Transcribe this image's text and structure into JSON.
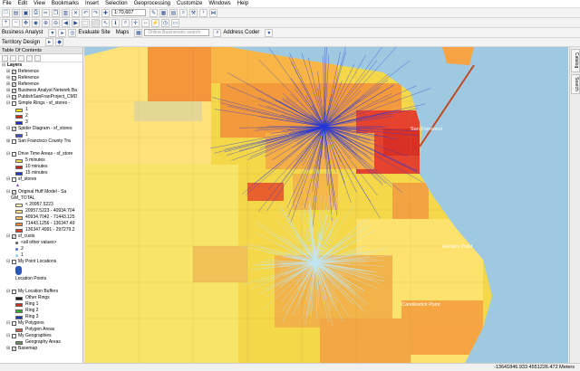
{
  "menubar": [
    "File",
    "Edit",
    "View",
    "Bookmarks",
    "Insert",
    "Selection",
    "Geoprocessing",
    "Customize",
    "Windows",
    "Help"
  ],
  "toolbar": {
    "scale": "1:70,607",
    "business_analyst": "Business Analyst",
    "evaluate_site": "Evaluate Site",
    "maps": "Maps",
    "search_placeholder": "Online Businesses search",
    "address_coder": "Address Coder",
    "territory_design": "Territory Design"
  },
  "toc": {
    "title": "Table Of Contents",
    "rows": [
      {
        "text": "Layers",
        "level": 0,
        "exp": "⊟",
        "check": false,
        "bold": true
      },
      {
        "text": "Reference",
        "level": 1,
        "exp": "⊞",
        "check": true
      },
      {
        "text": "Reference",
        "level": 1,
        "exp": "⊞",
        "check": true
      },
      {
        "text": "Reference",
        "level": 1,
        "exp": "⊞",
        "check": true
      },
      {
        "text": "Business Analyst Network Ba",
        "level": 1,
        "exp": "⊞",
        "check": true
      },
      {
        "text": "PublishSanFranProject_CMD",
        "level": 1,
        "exp": "⊟",
        "check": true
      },
      {
        "text": "Simple Rings - sf_stores -",
        "level": 1,
        "exp": "⊟",
        "check": false
      },
      {
        "text": "1",
        "level": 3,
        "swatch": "#f2e600"
      },
      {
        "text": "2",
        "level": 3,
        "swatch": "#e0261c"
      },
      {
        "text": "3",
        "level": 3,
        "swatch": "#1c2fe0"
      },
      {
        "text": "Spider Diagram - sf_stores",
        "level": 1,
        "exp": "⊟",
        "check": true
      },
      {
        "text": "1",
        "level": 3,
        "swatch": "#3c4fd0"
      },
      {
        "text": "San Francisco County Tra",
        "level": 1,
        "exp": "⊞",
        "check": false
      },
      {
        "text": "",
        "level": 3
      },
      {
        "text": "Drive Time Areas - sf_store",
        "level": 1,
        "exp": "⊟",
        "check": false
      },
      {
        "text": "5 minutes",
        "level": 3,
        "swatch": "#f0d64a"
      },
      {
        "text": "10 minutes",
        "level": 3,
        "swatch": "#d2261b"
      },
      {
        "text": "15 minutes",
        "level": 3,
        "swatch": "#1c3ad4"
      },
      {
        "text": "sf_stores",
        "level": 1,
        "exp": "⊟",
        "check": false
      },
      {
        "text": "▲",
        "level": 3,
        "color": "#7b32b6"
      },
      {
        "text": "Original Huff Model - Sa",
        "level": 1,
        "exp": "⊟",
        "check": true
      },
      {
        "text": "GM_TOTAL",
        "level": 2
      },
      {
        "text": "< 20957.5223",
        "level": 3,
        "swatch": "#ffffb0"
      },
      {
        "text": "20957.5223 - 40934.704",
        "level": 3,
        "swatch": "#fde27a"
      },
      {
        "text": "40934.7042 - 71443.125",
        "level": 3,
        "swatch": "#fdb95a"
      },
      {
        "text": "71443.1256 - 136347.49",
        "level": 3,
        "swatch": "#f7853c"
      },
      {
        "text": "136347.4991 - 297279.2",
        "level": 3,
        "swatch": "#e43a2a"
      },
      {
        "text": "sf_custs",
        "level": 1,
        "exp": "⊟",
        "check": true
      },
      {
        "text": "<all other values>",
        "level": 3,
        "dot": "#555555"
      },
      {
        "text": "2",
        "level": 3,
        "dot": "#5070d8"
      },
      {
        "text": "1",
        "level": 3,
        "dot": "#8fd0f0"
      },
      {
        "text": "My Point Locations",
        "level": 1,
        "exp": "⊟",
        "check": false
      },
      {
        "text": "",
        "level": 3,
        "pin": true
      },
      {
        "text": "Location Points",
        "level": 3
      },
      {
        "text": "",
        "level": 3
      },
      {
        "text": "My Location Buffers",
        "level": 1,
        "exp": "⊟",
        "check": false
      },
      {
        "text": "Other Rings",
        "level": 3,
        "swatch": "#1a1a1a"
      },
      {
        "text": "Ring 1",
        "level": 3,
        "swatch": "#d42a1f"
      },
      {
        "text": "Ring 2",
        "level": 3,
        "swatch": "#2fb32a"
      },
      {
        "text": "Ring 3",
        "level": 3,
        "swatch": "#2438c8"
      },
      {
        "text": "My Polygons",
        "level": 1,
        "exp": "⊟",
        "check": false
      },
      {
        "text": "Polygon Areas",
        "level": 3,
        "swatch": "#c85a50"
      },
      {
        "text": "My Geographies",
        "level": 1,
        "exp": "⊟",
        "check": false
      },
      {
        "text": "Geography Areas",
        "level": 3,
        "swatch": "#6c8a5a"
      },
      {
        "text": "Basemap",
        "level": 1,
        "exp": "⊞",
        "check": true
      }
    ]
  },
  "map_labels": {
    "san_francisco": "San Francisco",
    "hunters_point": "Hunters Point",
    "candlestick_point": "Candlestick Point"
  },
  "right_tabs": [
    "Catalog",
    "Search"
  ],
  "status": {
    "coords": "-13641846.933  4551226.472 Meters"
  },
  "colors": {
    "water": "#9ec9e0",
    "spider_blue": "#2438d8",
    "spider_light": "#bfe6f5"
  }
}
